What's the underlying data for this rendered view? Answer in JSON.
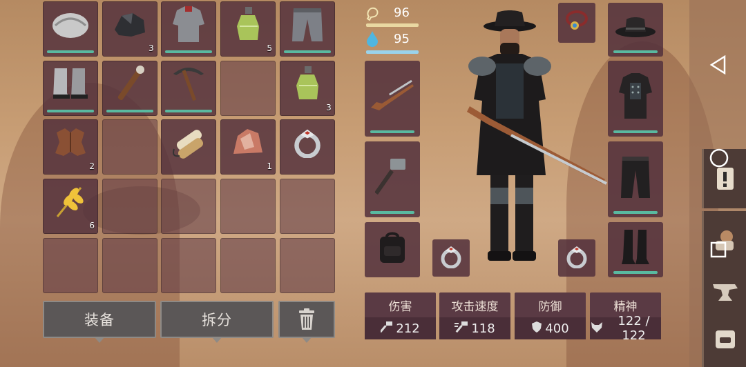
{
  "stats": {
    "food": "96",
    "water": "95"
  },
  "inventory": [
    {
      "item": "fur-hat-icon",
      "count": "",
      "bar": true
    },
    {
      "item": "coal-icon",
      "count": "3",
      "bar": false
    },
    {
      "item": "fur-jacket-icon",
      "count": "",
      "bar": true
    },
    {
      "item": "potion-bottle-icon",
      "count": "5",
      "bar": false
    },
    {
      "item": "fur-pants-icon",
      "count": "",
      "bar": true
    },
    {
      "item": "fur-boots-icon",
      "count": "",
      "bar": true
    },
    {
      "item": "wooden-club-icon",
      "count": "",
      "bar": true
    },
    {
      "item": "pickaxe-icon",
      "count": "",
      "bar": true
    },
    {
      "item": "",
      "count": "",
      "bar": false
    },
    {
      "item": "potion-bottle-icon",
      "count": "3",
      "bar": false
    },
    {
      "item": "animal-hide-icon",
      "count": "2",
      "bar": false
    },
    {
      "item": "",
      "count": "",
      "bar": false
    },
    {
      "item": "rope-bundle-icon",
      "count": "",
      "bar": false
    },
    {
      "item": "raw-meat-stone-icon",
      "count": "1",
      "bar": false
    },
    {
      "item": "ring-icon",
      "count": "",
      "bar": false
    },
    {
      "item": "wheat-icon",
      "count": "6",
      "bar": false
    },
    {
      "item": "",
      "count": "",
      "bar": false
    },
    {
      "item": "",
      "count": "",
      "bar": false
    },
    {
      "item": "",
      "count": "",
      "bar": false
    },
    {
      "item": "",
      "count": "",
      "bar": false
    },
    {
      "item": "",
      "count": "",
      "bar": false
    },
    {
      "item": "",
      "count": "",
      "bar": false
    },
    {
      "item": "",
      "count": "",
      "bar": false
    },
    {
      "item": "",
      "count": "",
      "bar": false
    },
    {
      "item": "",
      "count": "",
      "bar": false
    }
  ],
  "buttons": {
    "equip": "装备",
    "disassemble": "拆分"
  },
  "stat_cards": [
    {
      "label": "伤害",
      "value": "212",
      "icon": "hammer-icon"
    },
    {
      "label": "攻击速度",
      "value": "118",
      "icon": "fast-hammer-icon"
    },
    {
      "label": "防御",
      "value": "400",
      "icon": "shield-icon"
    },
    {
      "label": "精神",
      "value": "122 / 122",
      "icon": "wolf-icon"
    }
  ],
  "equipment": {
    "weapon": "rifle-icon",
    "tool": "sledgehammer-icon",
    "bag": "backpack-icon",
    "ring_left": "ring-icon",
    "ring_right": "ring-icon",
    "amulet": "amulet-icon",
    "head": "cowboy-hat-icon",
    "body": "armored-coat-icon",
    "legs": "pants-icon",
    "feet": "boots-icon"
  },
  "colors": {
    "durability": "#59b9a0",
    "food_bar": "#e9d8a2",
    "water_bar": "#9ad3ea",
    "slot": "#52303c"
  }
}
